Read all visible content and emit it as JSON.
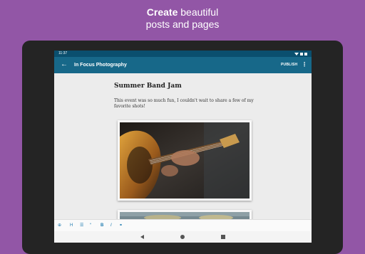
{
  "headline": {
    "bold": "Create",
    "rest": " beautiful",
    "line2": "posts and pages"
  },
  "status_bar": {
    "time": "11:37"
  },
  "app_bar": {
    "back_glyph": "←",
    "title": "In Focus Photography",
    "publish_label": "PUBLISH",
    "more_glyph": "⋮"
  },
  "post": {
    "title": "Summer Band Jam",
    "body": "This event was so much fun, I couldn't wait to share a few of my favorite shots!"
  },
  "toolbar": {
    "add": "⊕",
    "heading": "H",
    "list": "☰",
    "quote": "“",
    "bold": "B",
    "italic": "I",
    "link": "⚭"
  },
  "icons": {
    "back": "arrow-back-icon",
    "more": "more-vert-icon",
    "add": "add-block-icon",
    "heading": "heading-icon",
    "list": "list-icon",
    "quote": "quote-icon",
    "bold": "bold-icon",
    "italic": "italic-icon",
    "link": "link-icon"
  },
  "colors": {
    "background": "#9256a6",
    "app_bar": "#176889",
    "status_bar": "#0a4f6e",
    "accent": "#1e7bb0"
  }
}
